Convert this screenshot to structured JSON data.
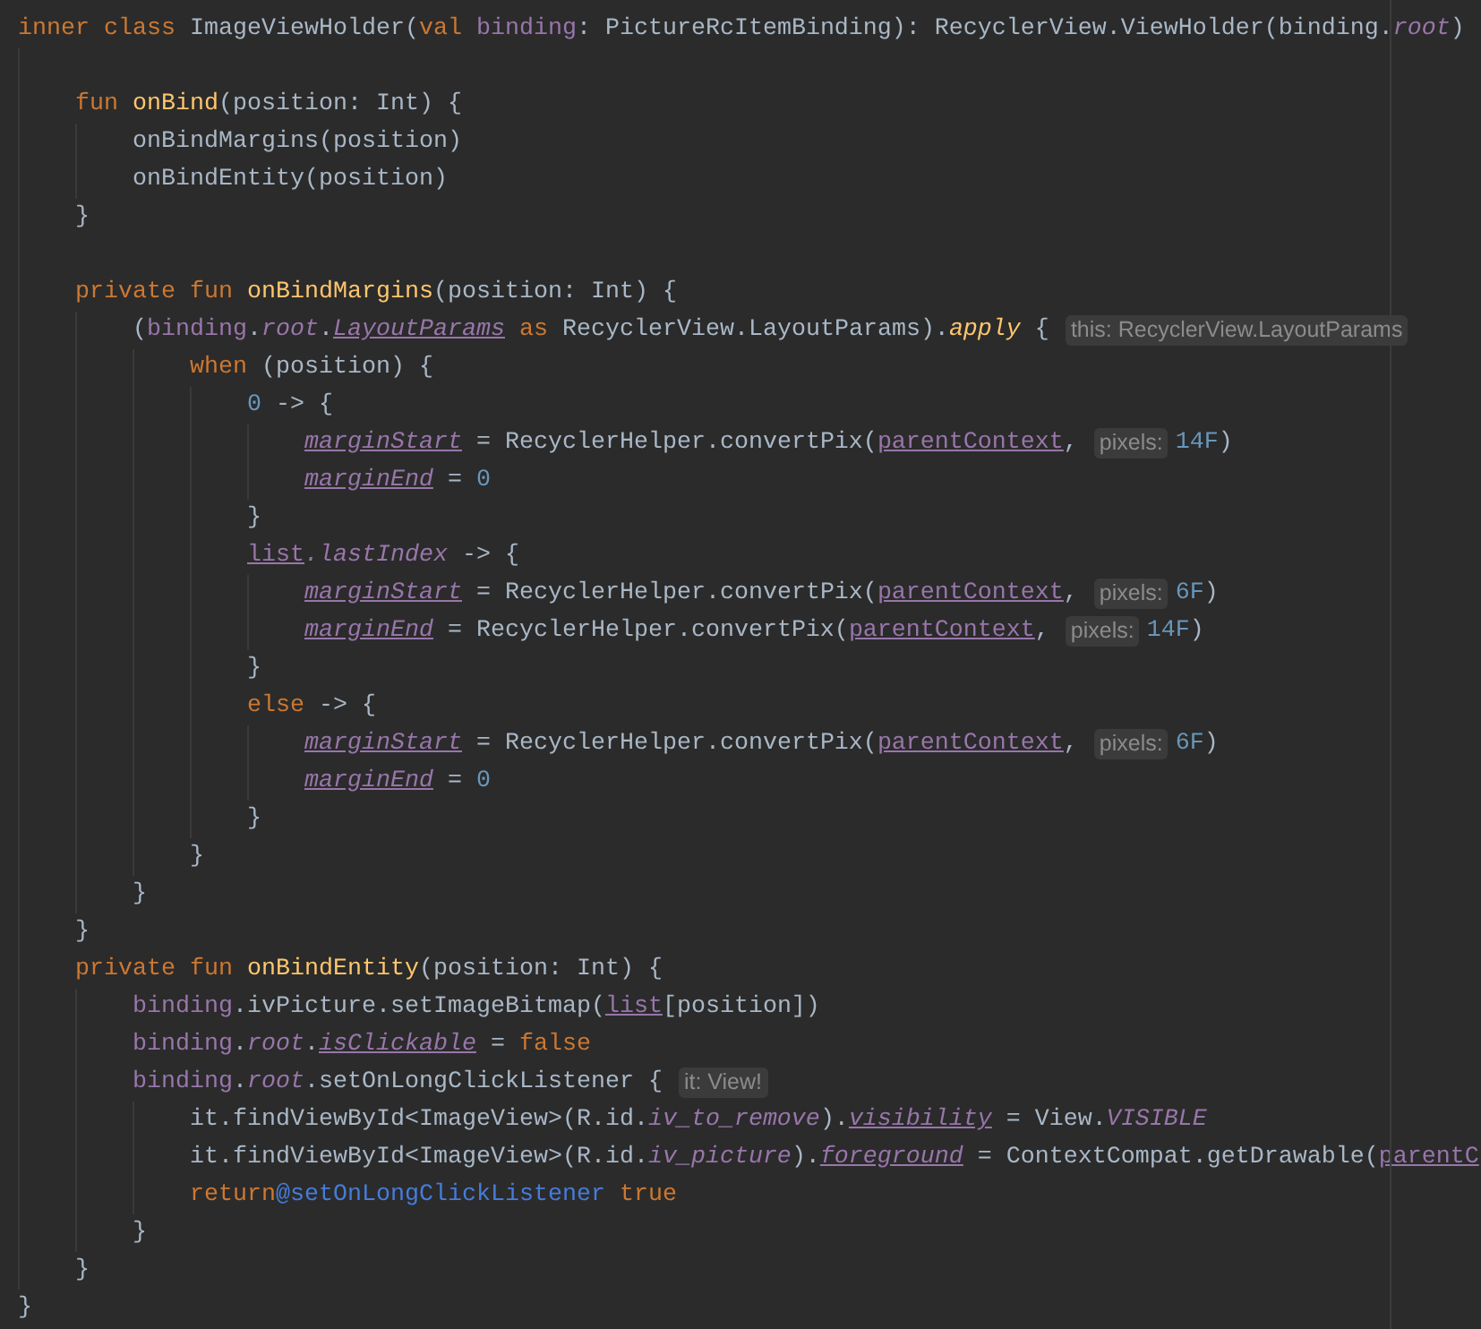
{
  "editor": {
    "lines": [
      {
        "kind": "code",
        "tokens": [
          {
            "kind": "kw",
            "text": "inner class "
          },
          {
            "kind": "plain",
            "text": "ImageViewHolder("
          },
          {
            "kind": "kw",
            "text": "val "
          },
          {
            "kind": "prop",
            "text": "binding"
          },
          {
            "kind": "plain",
            "text": ": PictureRcItemBinding): RecyclerView.ViewHolder(binding."
          },
          {
            "kind": "prop_i",
            "text": "root"
          },
          {
            "kind": "plain",
            "text": ")"
          }
        ],
        "children": [
          {
            "kind": "blank"
          },
          {
            "kind": "code",
            "tokens": [
              {
                "kind": "kw",
                "text": "fun "
              },
              {
                "kind": "fn",
                "text": "onBind"
              },
              {
                "kind": "plain",
                "text": "(position: Int) {"
              }
            ],
            "children": [
              {
                "kind": "code",
                "tokens": [
                  {
                    "kind": "plain",
                    "text": "onBindMargins(position)"
                  }
                ]
              },
              {
                "kind": "code",
                "tokens": [
                  {
                    "kind": "plain",
                    "text": "onBindEntity(position)"
                  }
                ]
              }
            ]
          },
          {
            "kind": "code",
            "tokens": [
              {
                "kind": "plain",
                "text": "}"
              }
            ]
          },
          {
            "kind": "blank"
          },
          {
            "kind": "code",
            "tokens": [
              {
                "kind": "kw",
                "text": "private fun "
              },
              {
                "kind": "fn",
                "text": "onBindMargins"
              },
              {
                "kind": "plain",
                "text": "(position: Int) {"
              }
            ],
            "children": [
              {
                "kind": "code",
                "tokens": [
                  {
                    "kind": "plain",
                    "text": "("
                  },
                  {
                    "kind": "prop",
                    "text": "binding"
                  },
                  {
                    "kind": "plain",
                    "text": "."
                  },
                  {
                    "kind": "prop_i",
                    "text": "root"
                  },
                  {
                    "kind": "plain",
                    "text": "."
                  },
                  {
                    "kind": "prop_iu",
                    "text": "LayoutParams"
                  },
                  {
                    "kind": "kw",
                    "text": " as "
                  },
                  {
                    "kind": "plain",
                    "text": "RecyclerView.LayoutParams)."
                  },
                  {
                    "kind": "ext",
                    "text": "apply"
                  },
                  {
                    "kind": "plain",
                    "text": " {"
                  },
                  {
                    "kind": "hint",
                    "text": "this: RecyclerView.LayoutParams"
                  }
                ],
                "children": [
                  {
                    "kind": "code",
                    "tokens": [
                      {
                        "kind": "kw",
                        "text": "when "
                      },
                      {
                        "kind": "plain",
                        "text": "(position) {"
                      }
                    ],
                    "children": [
                      {
                        "kind": "code",
                        "tokens": [
                          {
                            "kind": "num",
                            "text": "0"
                          },
                          {
                            "kind": "plain",
                            "text": " -> {"
                          }
                        ],
                        "children": [
                          {
                            "kind": "code",
                            "tokens": [
                              {
                                "kind": "prop_iu",
                                "text": "marginStart"
                              },
                              {
                                "kind": "plain",
                                "text": " = RecyclerHelper.convertPix("
                              },
                              {
                                "kind": "prop_u",
                                "text": "parentContext"
                              },
                              {
                                "kind": "plain",
                                "text": ","
                              },
                              {
                                "kind": "hint",
                                "text": "pixels:"
                              },
                              {
                                "kind": "num",
                                "text": "14F"
                              },
                              {
                                "kind": "plain",
                                "text": ")"
                              }
                            ]
                          },
                          {
                            "kind": "code",
                            "tokens": [
                              {
                                "kind": "prop_iu",
                                "text": "marginEnd"
                              },
                              {
                                "kind": "plain",
                                "text": " = "
                              },
                              {
                                "kind": "num",
                                "text": "0"
                              }
                            ]
                          }
                        ]
                      },
                      {
                        "kind": "code",
                        "tokens": [
                          {
                            "kind": "plain",
                            "text": "}"
                          }
                        ]
                      },
                      {
                        "kind": "code",
                        "tokens": [
                          {
                            "kind": "prop_u",
                            "text": "list"
                          },
                          {
                            "kind": "prop_i",
                            "text": ".lastIndex"
                          },
                          {
                            "kind": "plain",
                            "text": " -> {"
                          }
                        ],
                        "children": [
                          {
                            "kind": "code",
                            "tokens": [
                              {
                                "kind": "prop_iu",
                                "text": "marginStart"
                              },
                              {
                                "kind": "plain",
                                "text": " = RecyclerHelper.convertPix("
                              },
                              {
                                "kind": "prop_u",
                                "text": "parentContext"
                              },
                              {
                                "kind": "plain",
                                "text": ","
                              },
                              {
                                "kind": "hint",
                                "text": "pixels:"
                              },
                              {
                                "kind": "num",
                                "text": "6F"
                              },
                              {
                                "kind": "plain",
                                "text": ")"
                              }
                            ]
                          },
                          {
                            "kind": "code",
                            "tokens": [
                              {
                                "kind": "prop_iu",
                                "text": "marginEnd"
                              },
                              {
                                "kind": "plain",
                                "text": " = RecyclerHelper.convertPix("
                              },
                              {
                                "kind": "prop_u",
                                "text": "parentContext"
                              },
                              {
                                "kind": "plain",
                                "text": ","
                              },
                              {
                                "kind": "hint",
                                "text": "pixels:"
                              },
                              {
                                "kind": "num",
                                "text": "14F"
                              },
                              {
                                "kind": "plain",
                                "text": ")"
                              }
                            ]
                          }
                        ]
                      },
                      {
                        "kind": "code",
                        "tokens": [
                          {
                            "kind": "plain",
                            "text": "}"
                          }
                        ]
                      },
                      {
                        "kind": "code",
                        "tokens": [
                          {
                            "kind": "kw",
                            "text": "else"
                          },
                          {
                            "kind": "plain",
                            "text": " -> {"
                          }
                        ],
                        "children": [
                          {
                            "kind": "code",
                            "tokens": [
                              {
                                "kind": "prop_iu",
                                "text": "marginStart"
                              },
                              {
                                "kind": "plain",
                                "text": " = RecyclerHelper.convertPix("
                              },
                              {
                                "kind": "prop_u",
                                "text": "parentContext"
                              },
                              {
                                "kind": "plain",
                                "text": ","
                              },
                              {
                                "kind": "hint",
                                "text": "pixels:"
                              },
                              {
                                "kind": "num",
                                "text": "6F"
                              },
                              {
                                "kind": "plain",
                                "text": ")"
                              }
                            ]
                          },
                          {
                            "kind": "code",
                            "tokens": [
                              {
                                "kind": "prop_iu",
                                "text": "marginEnd"
                              },
                              {
                                "kind": "plain",
                                "text": " = "
                              },
                              {
                                "kind": "num",
                                "text": "0"
                              }
                            ]
                          }
                        ]
                      },
                      {
                        "kind": "code",
                        "tokens": [
                          {
                            "kind": "plain",
                            "text": "}"
                          }
                        ]
                      }
                    ]
                  },
                  {
                    "kind": "code",
                    "tokens": [
                      {
                        "kind": "plain",
                        "text": "}"
                      }
                    ]
                  }
                ]
              },
              {
                "kind": "code",
                "tokens": [
                  {
                    "kind": "plain",
                    "text": "}"
                  }
                ]
              }
            ]
          },
          {
            "kind": "code",
            "tokens": [
              {
                "kind": "plain",
                "text": "}"
              }
            ]
          },
          {
            "kind": "code",
            "tokens": [
              {
                "kind": "kw",
                "text": "private fun "
              },
              {
                "kind": "fn",
                "text": "onBindEntity"
              },
              {
                "kind": "plain",
                "text": "(position: Int) {"
              }
            ],
            "children": [
              {
                "kind": "code",
                "tokens": [
                  {
                    "kind": "prop",
                    "text": "binding"
                  },
                  {
                    "kind": "plain",
                    "text": ".ivPicture.setImageBitmap("
                  },
                  {
                    "kind": "prop_u",
                    "text": "list"
                  },
                  {
                    "kind": "plain",
                    "text": "[position])"
                  }
                ]
              },
              {
                "kind": "code",
                "tokens": [
                  {
                    "kind": "prop",
                    "text": "binding"
                  },
                  {
                    "kind": "plain",
                    "text": "."
                  },
                  {
                    "kind": "prop_i",
                    "text": "root"
                  },
                  {
                    "kind": "plain",
                    "text": "."
                  },
                  {
                    "kind": "prop_iu",
                    "text": "isClickable"
                  },
                  {
                    "kind": "plain",
                    "text": " = "
                  },
                  {
                    "kind": "kw",
                    "text": "false"
                  }
                ]
              },
              {
                "kind": "code",
                "tokens": [
                  {
                    "kind": "prop",
                    "text": "binding"
                  },
                  {
                    "kind": "plain",
                    "text": "."
                  },
                  {
                    "kind": "prop_i",
                    "text": "root"
                  },
                  {
                    "kind": "plain",
                    "text": ".setOnLongClickListener {"
                  },
                  {
                    "kind": "hint",
                    "text": "it: View!"
                  }
                ],
                "children": [
                  {
                    "kind": "code",
                    "tokens": [
                      {
                        "kind": "plain",
                        "text": "it.findViewById<ImageView>(R.id."
                      },
                      {
                        "kind": "prop_i",
                        "text": "iv_to_remove"
                      },
                      {
                        "kind": "plain",
                        "text": ")."
                      },
                      {
                        "kind": "prop_iu",
                        "text": "visibility"
                      },
                      {
                        "kind": "plain",
                        "text": " = View."
                      },
                      {
                        "kind": "prop_i",
                        "text": "VISIBLE"
                      }
                    ]
                  },
                  {
                    "kind": "code",
                    "tokens": [
                      {
                        "kind": "plain",
                        "text": "it.findViewById<ImageView>(R.id."
                      },
                      {
                        "kind": "prop_i",
                        "text": "iv_picture"
                      },
                      {
                        "kind": "plain",
                        "text": ")."
                      },
                      {
                        "kind": "prop_iu",
                        "text": "foreground"
                      },
                      {
                        "kind": "plain",
                        "text": " = ContextCompat.getDrawable("
                      },
                      {
                        "kind": "prop_u",
                        "text": "parentC"
                      }
                    ]
                  },
                  {
                    "kind": "code",
                    "tokens": [
                      {
                        "kind": "kw",
                        "text": "return"
                      },
                      {
                        "kind": "label",
                        "text": "@setOnLongClickListener"
                      },
                      {
                        "kind": "kw",
                        "text": " true"
                      }
                    ]
                  }
                ]
              },
              {
                "kind": "code",
                "tokens": [
                  {
                    "kind": "plain",
                    "text": "}"
                  }
                ]
              }
            ]
          },
          {
            "kind": "code",
            "tokens": [
              {
                "kind": "plain",
                "text": "}"
              }
            ]
          }
        ]
      },
      {
        "kind": "code",
        "tokens": [
          {
            "kind": "plain",
            "text": "}"
          }
        ]
      }
    ]
  }
}
